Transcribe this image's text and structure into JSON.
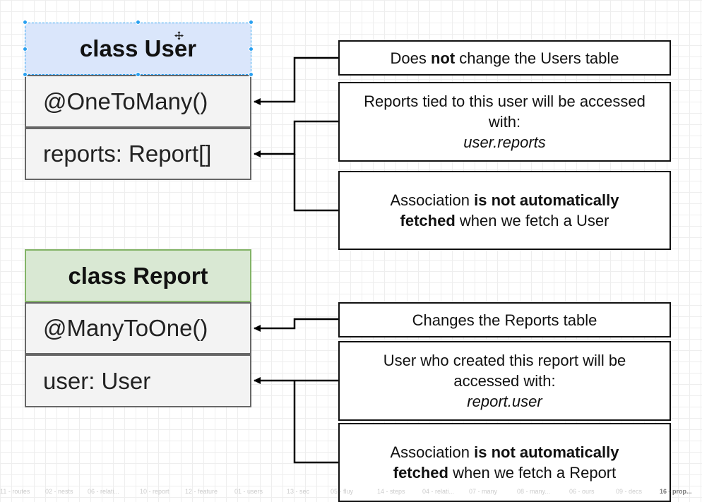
{
  "diagram": {
    "user_class": {
      "title": "class User",
      "rows": [
        "@OneToMany()",
        "reports: Report[]"
      ],
      "header_color": "#dae6fb",
      "selected": true
    },
    "report_class": {
      "title": "class Report",
      "rows": [
        "@ManyToOne()",
        "user: User"
      ],
      "header_color": "#d9e8d3"
    },
    "notes": {
      "users_table": {
        "pre": "Does ",
        "bold": "not",
        "post": " change the Users table"
      },
      "reports_access": {
        "line1": "Reports tied to this user will be accessed",
        "line2": "with:",
        "code": "user.reports"
      },
      "user_assoc": {
        "pre": "Association ",
        "bold1": "is not automatically",
        "bold2": "fetched",
        "post": " when we fetch a User"
      },
      "reports_table": {
        "text": "Changes the Reports table"
      },
      "user_access": {
        "line1": "User who created this report will be",
        "line2": "accessed with:",
        "code": "report.user"
      },
      "report_assoc": {
        "pre": "Association ",
        "bold1": "is not automatically",
        "bold2": "fetched",
        "post": " when we fetch a Report"
      }
    },
    "colors": {
      "selection": "#29a0f0",
      "arrow": "#000000"
    }
  },
  "tabs": [
    {
      "label": "11 - routes"
    },
    {
      "label": "02 - nests"
    },
    {
      "label": "06 - relati..."
    },
    {
      "label": "10 - report"
    },
    {
      "label": "12 - feature"
    },
    {
      "label": "01 - users"
    },
    {
      "label": "13 - sec"
    },
    {
      "label": "05 - fluy"
    },
    {
      "label": "14 - steps"
    },
    {
      "label": "04 - relati..."
    },
    {
      "label": "07 - many"
    },
    {
      "label": "08 - many..."
    },
    {
      "label": "06 - ours"
    },
    {
      "label": "09 - decs"
    },
    {
      "label": "16 - prop...",
      "active": true
    }
  ]
}
